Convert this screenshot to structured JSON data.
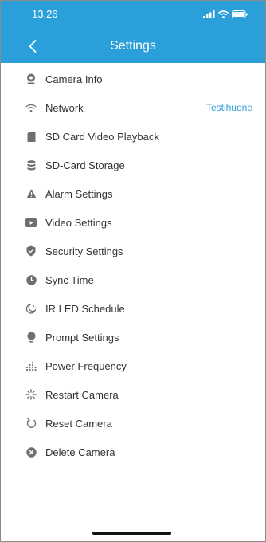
{
  "status_bar": {
    "time": "13.26"
  },
  "nav": {
    "title": "Settings"
  },
  "colors": {
    "header": "#2b9fd9",
    "accent": "#2b9fd9",
    "icon": "#6e6e6e"
  },
  "settings": [
    {
      "label": "Camera Info",
      "icon": "webcam-icon"
    },
    {
      "label": "Network",
      "icon": "wifi-icon",
      "value": "Testihuone"
    },
    {
      "label": "SD Card Video Playback",
      "icon": "sd-card-icon"
    },
    {
      "label": "SD-Card Storage",
      "icon": "storage-icon"
    },
    {
      "label": "Alarm Settings",
      "icon": "warning-icon"
    },
    {
      "label": "Video Settings",
      "icon": "play-icon"
    },
    {
      "label": "Security Settings",
      "icon": "shield-icon"
    },
    {
      "label": "Sync Time",
      "icon": "clock-icon"
    },
    {
      "label": "IR LED Schedule",
      "icon": "night-icon"
    },
    {
      "label": "Prompt Settings",
      "icon": "bulb-icon"
    },
    {
      "label": "Power Frequency",
      "icon": "frequency-icon"
    },
    {
      "label": "Restart Camera",
      "icon": "loading-icon"
    },
    {
      "label": "Reset Camera",
      "icon": "reset-icon"
    },
    {
      "label": "Delete Camera",
      "icon": "delete-icon"
    }
  ]
}
